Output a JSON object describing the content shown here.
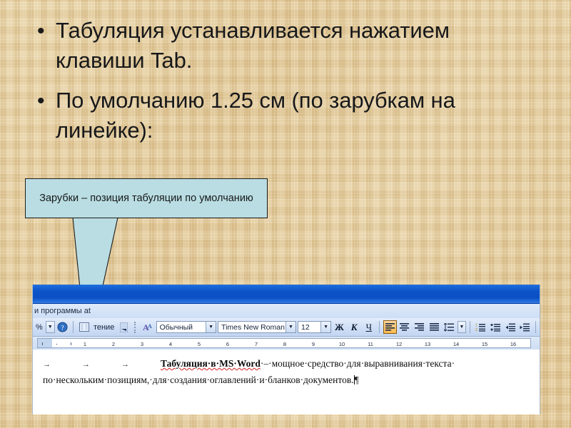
{
  "slide": {
    "background_color": "#e8cd94",
    "bullets": [
      {
        "marker": "•",
        "text": "Табуляция устанавливается нажатием клавиши Tab."
      },
      {
        "marker": "•",
        "text": "По умолчанию 1.25 см (по зарубкам на линейке):"
      }
    ]
  },
  "callout": {
    "text": "Зарубки – позиция табуляции по умолчанию",
    "fill_color": "#b9dde2",
    "border_color": "#1d1d1d"
  },
  "word_window": {
    "titlebar": {
      "text": "",
      "color": "#0d53c8"
    },
    "menubar": {
      "text": "и программы    at"
    },
    "toolbar": {
      "zoom_label": "%",
      "zoom_dropdown_icon": "chevron-down-icon",
      "help_icon": "help-icon",
      "read_button_icon": "read-layout-icon",
      "read_label": "тение",
      "styles_icon": "styles-icon",
      "style_value": "Обычный",
      "font_value": "Times New Roman",
      "size_value": "12",
      "bold_label": "Ж",
      "italic_label": "К",
      "underline_label": "Ч",
      "align_left_icon": "align-left-icon",
      "align_center_icon": "align-center-icon",
      "align_right_icon": "align-right-icon",
      "align_justify_icon": "align-justify-icon",
      "line_spacing_icon": "line-spacing-icon",
      "numbered_list_icon": "numbered-list-icon",
      "bullet_list_icon": "bullet-list-icon",
      "decrease_indent_icon": "decrease-indent-icon",
      "increase_indent_icon": "increase-indent-icon",
      "active_button": "align-left-icon",
      "active_color": "#fbb94d"
    },
    "ruler": {
      "unit": "cm",
      "ticks": [
        1,
        2,
        3,
        4,
        5,
        6,
        7,
        8,
        9,
        10,
        11,
        12,
        13,
        14,
        15,
        16
      ],
      "default_tab_stop_cm": 1.25,
      "left_indent_marker": "hourglass-indent-icon",
      "right_indent_marker": "right-indent-icon"
    },
    "document": {
      "tab_marks": [
        "→",
        "→",
        "→"
      ],
      "bold_run": "Табуляция·в·MS·Word",
      "line1_rest": "·–·мощное·средство·для·выравнивания·текста·",
      "line2": "по·нескольким·позициям,·для·создания·оглавлений·и·бланков·документов.",
      "paragraph_mark": "¶"
    }
  }
}
